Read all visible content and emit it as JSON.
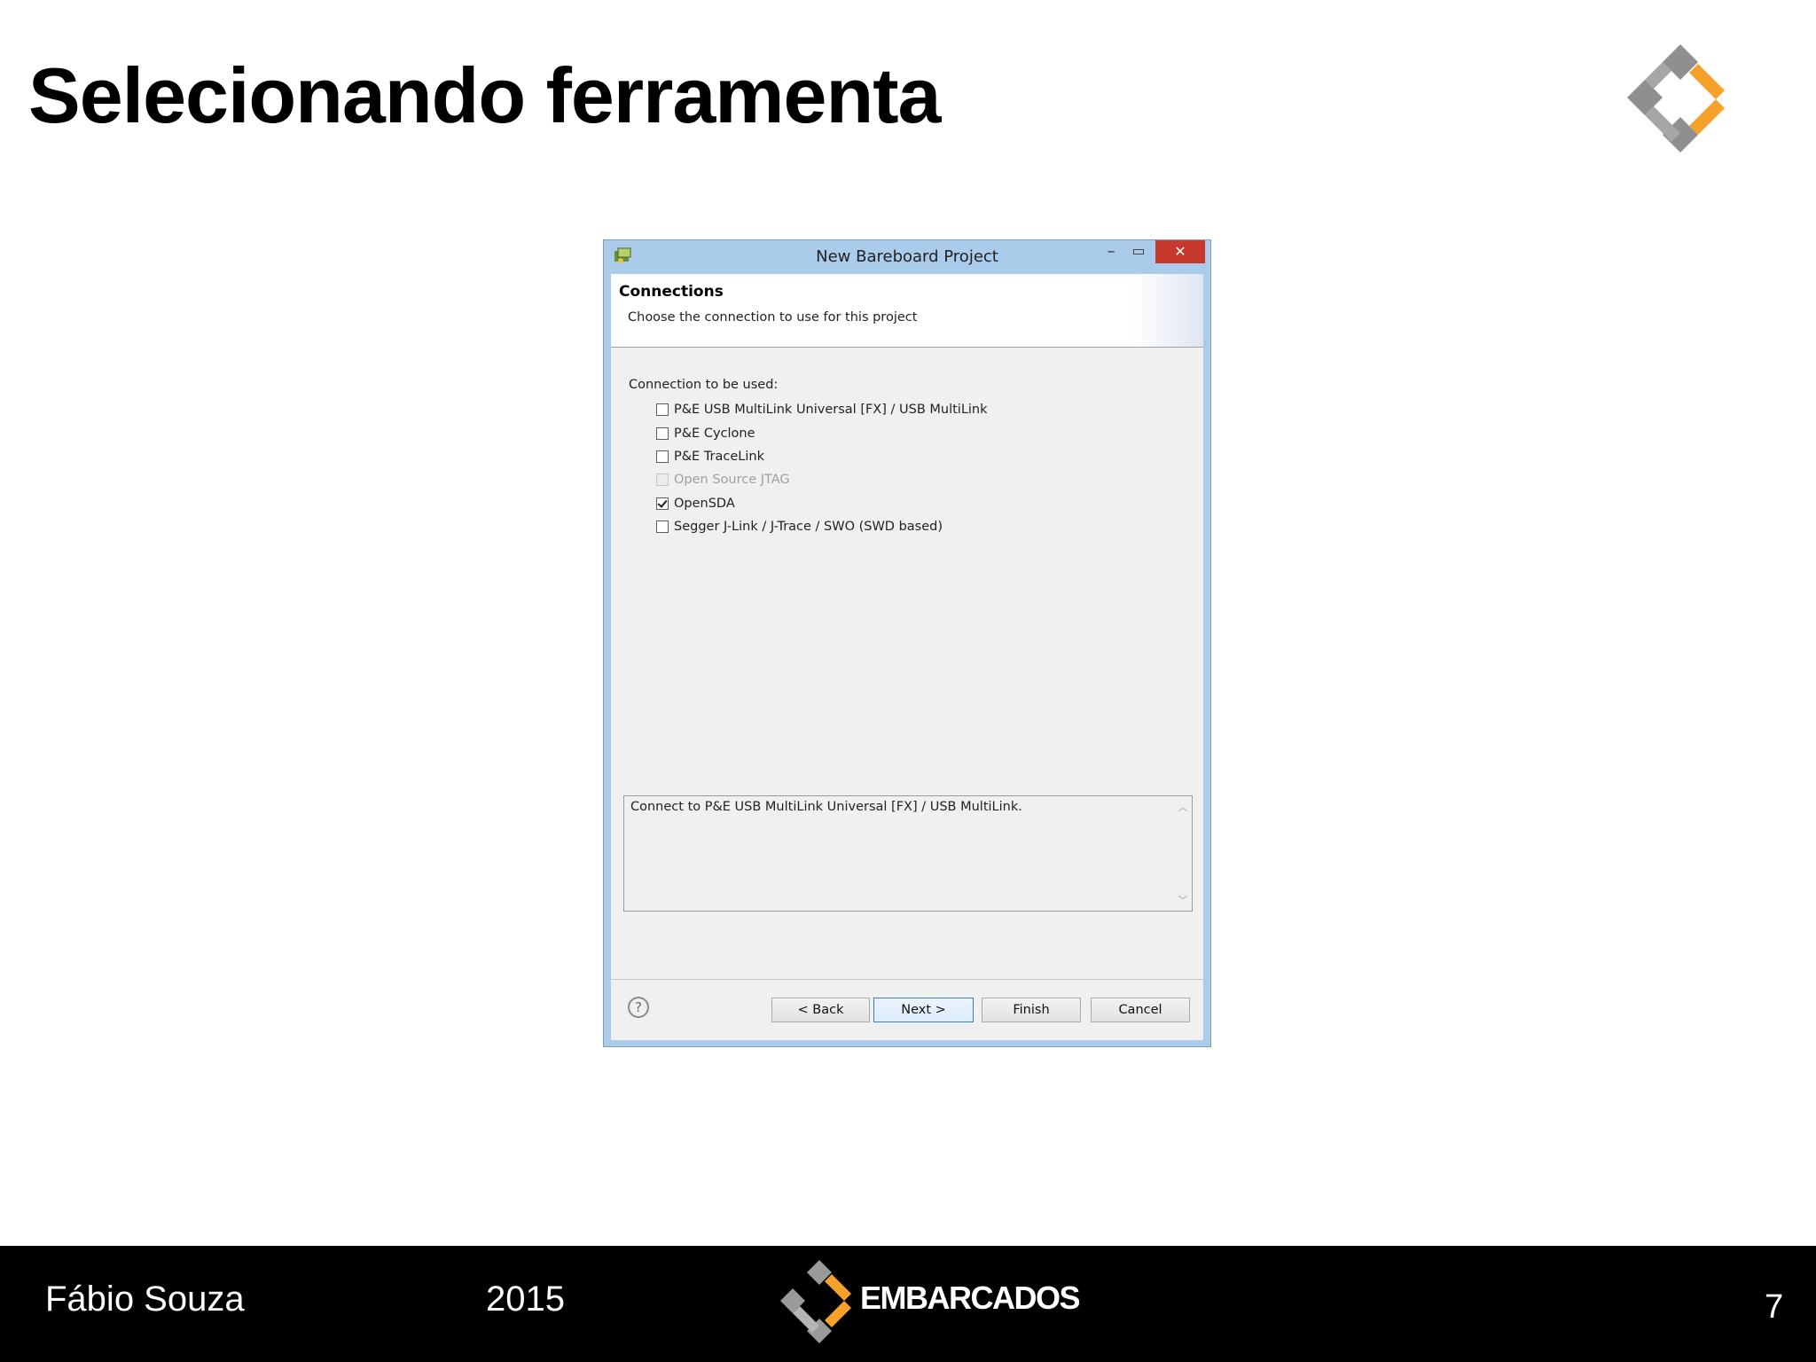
{
  "slide": {
    "title": "Selecionando ferramenta",
    "logo_icon": "embarcados-logo-icon"
  },
  "dialog": {
    "title": "New Bareboard Project",
    "app_icon": "cw-project-icon",
    "window_controls": {
      "minimize": "minimize-icon",
      "maximize": "maximize-icon",
      "close": "close-icon"
    },
    "header": {
      "title": "Connections",
      "subtitle": "Choose the connection to use for this project"
    },
    "connection_label": "Connection to be used:",
    "options": [
      {
        "label": "P&E USB MultiLink Universal [FX] / USB MultiLink",
        "checked": false,
        "enabled": true
      },
      {
        "label": "P&E Cyclone",
        "checked": false,
        "enabled": true
      },
      {
        "label": "P&E TraceLink",
        "checked": false,
        "enabled": true
      },
      {
        "label": "Open Source JTAG",
        "checked": false,
        "enabled": false
      },
      {
        "label": "OpenSDA",
        "checked": true,
        "enabled": true
      },
      {
        "label": "Segger J-Link / J-Trace / SWO (SWD based)",
        "checked": false,
        "enabled": true
      }
    ],
    "description": "Connect to P&E USB MultiLink Universal [FX] / USB MultiLink.",
    "help_icon": "help-icon",
    "buttons": {
      "back": "< Back",
      "next": "Next >",
      "finish": "Finish",
      "cancel": "Cancel"
    }
  },
  "footer": {
    "author": "Fábio Souza",
    "year": "2015",
    "brand": "EMBARCADOS",
    "page": "7"
  },
  "colors": {
    "accent_orange": "#f7a12d",
    "logo_gray": "#8f8f8f",
    "close_red": "#c7392c",
    "dialog_frame": "#aacbea"
  }
}
